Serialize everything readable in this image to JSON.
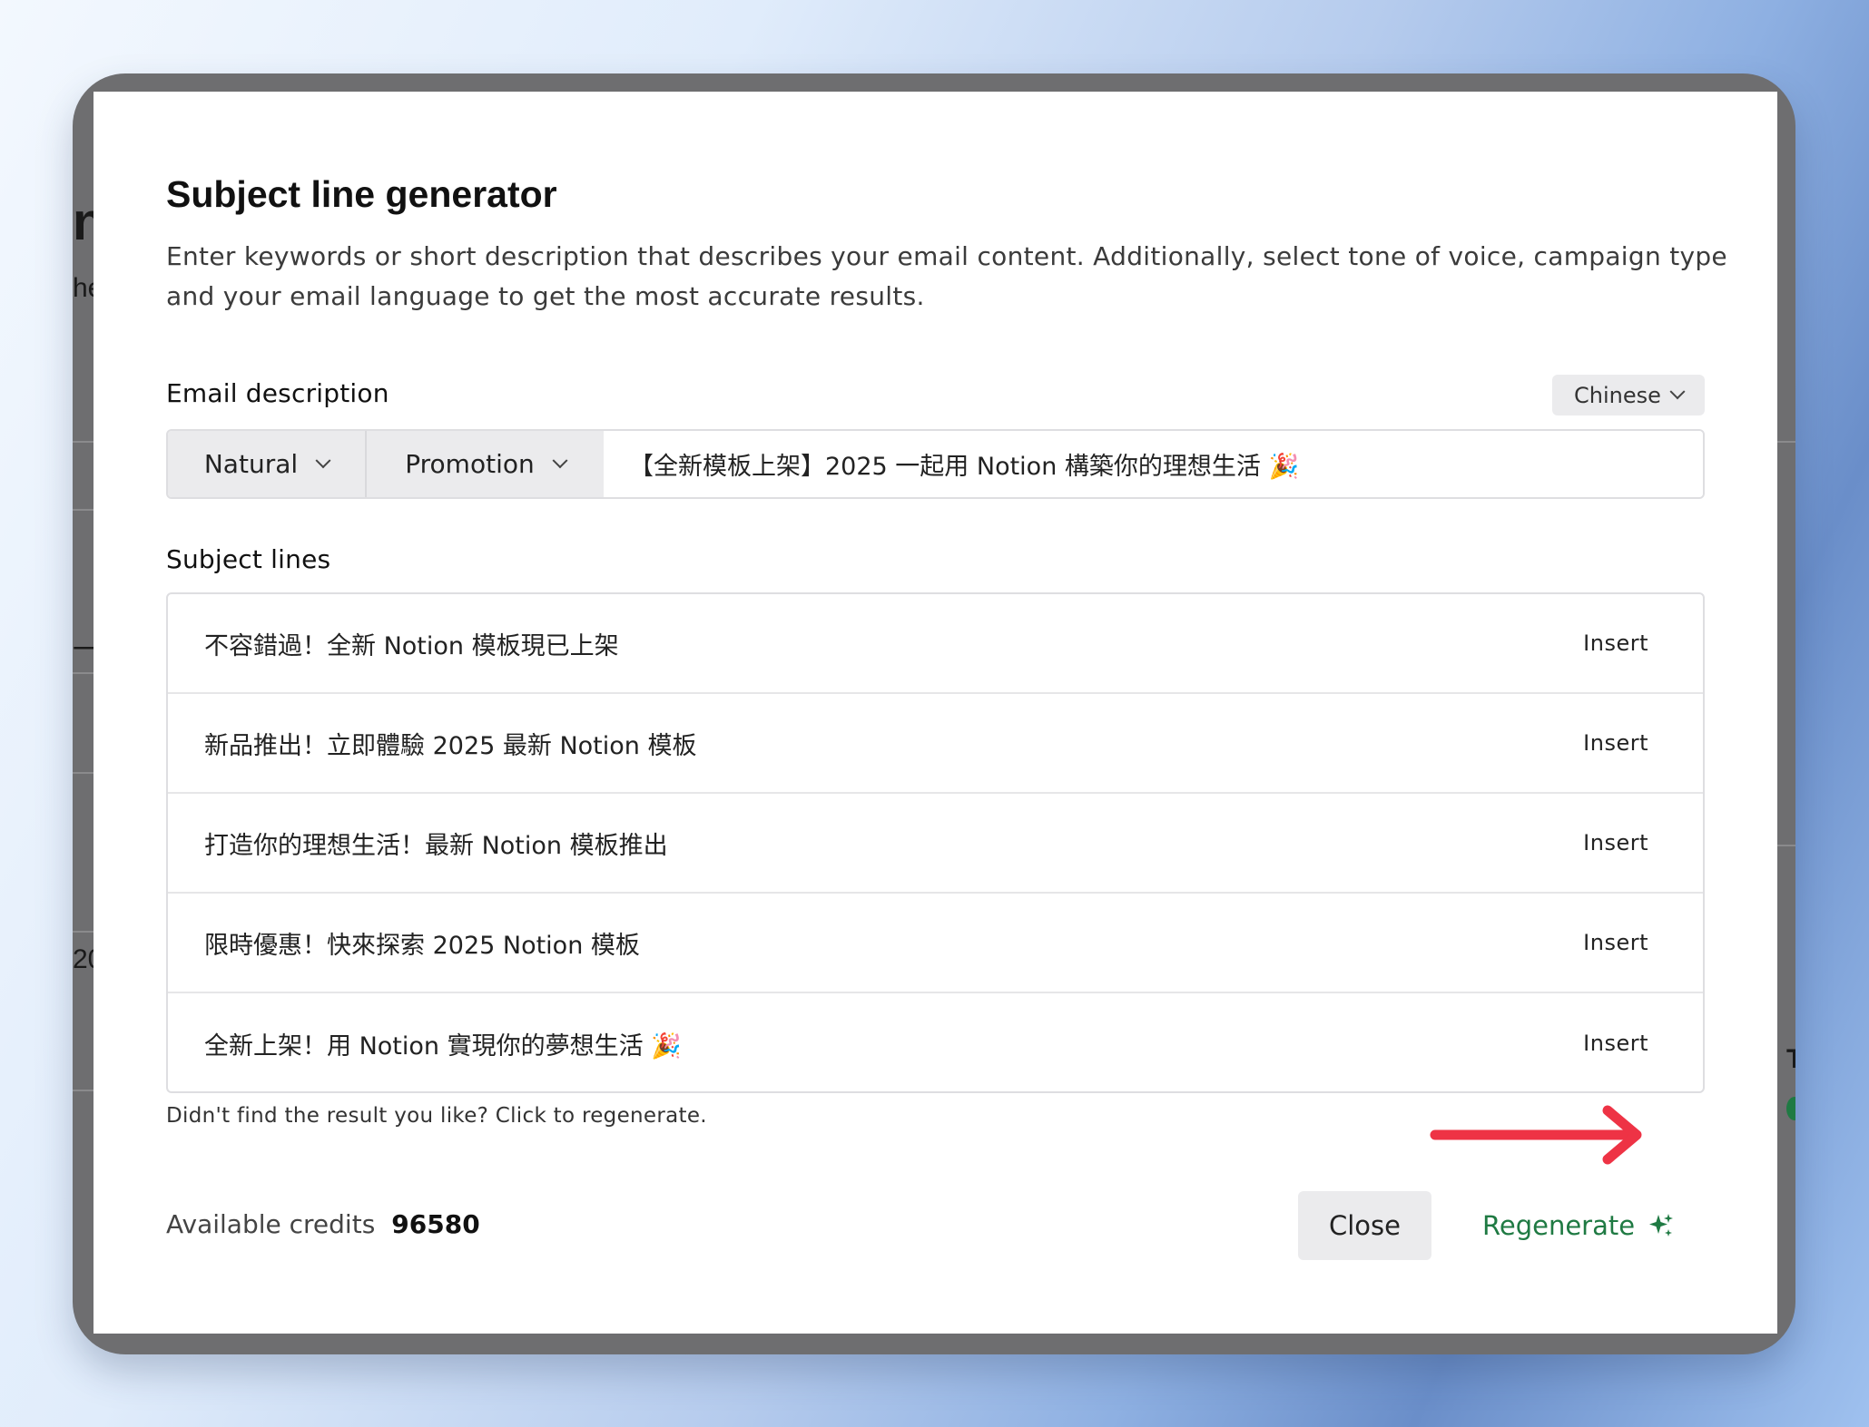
{
  "dialog": {
    "title": "Subject line generator",
    "description": "Enter keywords or short description that describes your email content. Additionally, select tone of voice, campaign type and your email language to get the most accurate results.",
    "email_description_label": "Email description",
    "language_select": "Chinese",
    "tone_select": "Natural",
    "campaign_select": "Promotion",
    "description_value": "【全新模板上架】2025 一起用 Notion 構築你的理想生活 🎉",
    "subject_lines_label": "Subject lines",
    "insert_label": "Insert",
    "subject_lines": [
      "不容錯過！全新 Notion 模板現已上架",
      "新品推出！立即體驗 2025 最新 Notion 模板",
      "打造你的理想生活！最新 Notion 模板推出",
      "限時優惠！快來探索 2025 Notion 模板",
      "全新上架！用 Notion 實現你的夢想生活 🎉"
    ],
    "regenerate_hint": "Didn't find the result you like? Click to regenerate.",
    "credits_label": "Available credits",
    "credits_value": "96580",
    "close_label": "Close",
    "regenerate_label": "Regenerate"
  },
  "behind": {
    "fragments": [
      "n",
      "he",
      "一",
      "20",
      "T"
    ]
  },
  "colors": {
    "accent_green": "#1f7a43",
    "annotation_red": "#ee3345",
    "button_gray": "#ebebed"
  }
}
